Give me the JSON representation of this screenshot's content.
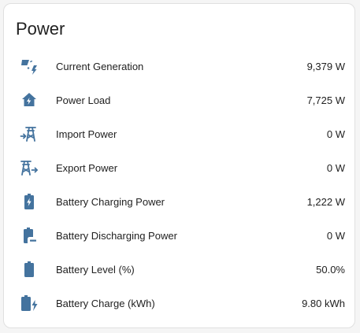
{
  "card": {
    "title": "Power"
  },
  "colors": {
    "icon": "#44739e",
    "text": "#212121",
    "card_background": "#ffffff",
    "page_background": "#f5f5f5"
  },
  "entities": [
    {
      "icon": "solar-power-icon",
      "label": "Current Generation",
      "value": "9,379 W"
    },
    {
      "icon": "home-lightning-icon",
      "label": "Power Load",
      "value": "7,725 W"
    },
    {
      "icon": "transmission-tower-import-icon",
      "label": "Import Power",
      "value": "0 W"
    },
    {
      "icon": "transmission-tower-export-icon",
      "label": "Export Power",
      "value": "0 W"
    },
    {
      "icon": "battery-charging-icon",
      "label": "Battery Charging Power",
      "value": "1,222 W"
    },
    {
      "icon": "battery-minus-icon",
      "label": "Battery Discharging Power",
      "value": "0 W"
    },
    {
      "icon": "battery-icon",
      "label": "Battery Level (%)",
      "value": "50.0%"
    },
    {
      "icon": "battery-charging-high-icon",
      "label": "Battery Charge (kWh)",
      "value": "9.80 kWh"
    }
  ]
}
